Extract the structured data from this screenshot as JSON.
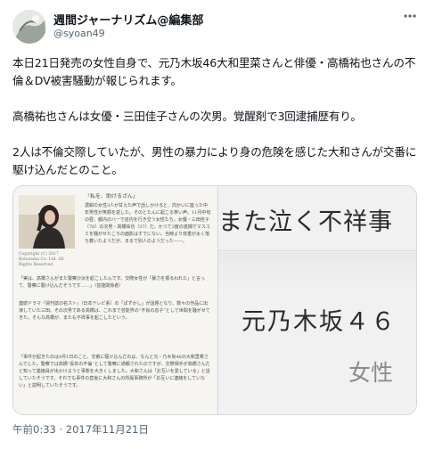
{
  "tweet": {
    "author": {
      "name": "週間ジャーナリズム@編集部",
      "handle": "@syoan49"
    },
    "paragraphs": [
      "本日21日発売の女性自身で、元乃木坂46大和里菜さんと俳優・高橋祐也さんの不倫＆DV被害騒動が報じられます。",
      "高橋祐也さんは女優・三田佳子さんの次男。覚醒剤で3回逮捕歴有り。",
      "2人は不倫交際していたが、男性の暴力により身の危険を感じた大和さんが交番に駆け込んだとのこと。"
    ],
    "timestamp": "午前0:33 · 2017年11月21日"
  },
  "media": {
    "left_panel": {
      "article_title": "「私を、助けるさん」",
      "photo_credit": "Copyright (C) 2017 Kobunsha Co. Ltd. All Rights Reserved.",
      "column_text": "濃紺の女性3人が甘えた声で話しかけると、向かいに座った中年男性が笑顔を返した。そのとたんに起こる笑い声。11月中旬の昼、都内のバーで店内を行き交う女性たち。女優・三田佳子（76）の次男・高橋祐也（37）だ。かつて3度の逮捕でマスコミを騒がせたころの面影はすでにない。当時より体重が太く落ち着いたようだが、まるで別人のようだった——。",
      "quote_text": "「実は、高橋さんがまた警察沙汰を起こしたんです。交際女性が「暴力を振るわれた」と言って、警察に駆け込んだそうです……」（芸能関係者）",
      "paragraph_text": "連続ドラマ『週刊誌の名スト』（日本テレビ系）の「ぱずかし」が話題となり、数々の作品に出演していた三田。その次男である高橋は、これまで芸能界の“不肖の息子”として世間を騒がせてきた。そんな高橋が、またも不祥事を起こしたという。",
      "paragraph2_text": "「事件が起きたのは9月1日のこと。交番に駆け込んだのは、なんと元・乃木坂46の大和里菜さんでした。警察では高橋“長年の不倫”として警察に通報されたのですが、交際相手が高橋さんだと知って連絡員が出かけようと事態を大きくしました。大和さんは「お互いを愛している」と話していたそうです。それでも事件の直後に大和さんの所属事務所が「お互いに連絡をしていない」と説明していたそうです。"
    },
    "right_panel": {
      "zoom_line_top": "また泣く不祥事",
      "zoom_line_mid": "元乃木坂４６",
      "zoom_line_bot": "女性"
    }
  },
  "icons": {
    "more": "more-horizontal-icon"
  }
}
